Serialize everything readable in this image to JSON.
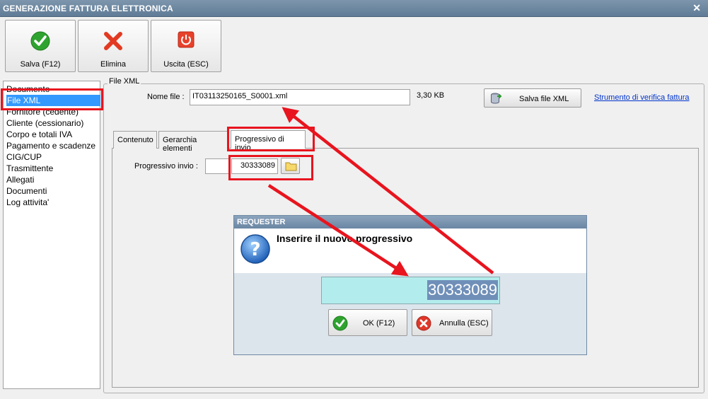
{
  "window": {
    "title": "GENERAZIONE FATTURA ELETTRONICA",
    "close_glyph": "✕"
  },
  "toolbar": {
    "save_label": "Salva (F12)",
    "delete_label": "Elimina",
    "exit_label": "Uscita (ESC)"
  },
  "sidebar": {
    "items": [
      {
        "label": "Documento"
      },
      {
        "label": "File XML"
      },
      {
        "label": "Fornitore (cedente)"
      },
      {
        "label": "Cliente (cessionario)"
      },
      {
        "label": "Corpo e totali IVA"
      },
      {
        "label": "Pagamento e scadenze"
      },
      {
        "label": "CIG/CUP"
      },
      {
        "label": "Trasmittente"
      },
      {
        "label": "Allegati"
      },
      {
        "label": "Documenti"
      },
      {
        "label": "Log attivita'"
      }
    ]
  },
  "filexml": {
    "group_label": "File XML",
    "name_label": "Nome file :",
    "name_value": "IT03113250165_S0001.xml",
    "size": "3,30 KB",
    "save_button": "Salva file XML",
    "verify_link": "Strumento di verifica fattura"
  },
  "tabs": [
    {
      "label": "Contenuto"
    },
    {
      "label": "Gerarchia elementi"
    },
    {
      "label": "Progressivo di invio"
    }
  ],
  "progressivo": {
    "label": "Progressivo invio :",
    "value": "30333089"
  },
  "dialog": {
    "title": "REQUESTER",
    "message": "Inserire il nuovo progressivo",
    "input_value": "30333089",
    "ok_label": "OK (F12)",
    "cancel_label": "Annulla (ESC)"
  },
  "colors": {
    "highlight": "#e8141e",
    "selection": "#3399ff",
    "dialog_input": "#b3ecec"
  }
}
